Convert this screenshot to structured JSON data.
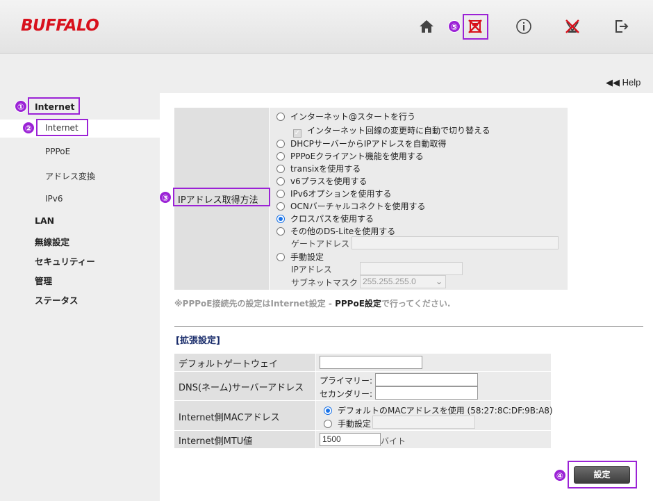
{
  "header": {
    "logo": "BUFFALO",
    "icons": [
      "home-icon",
      "network-disconnect-icon",
      "info-icon",
      "wireless-off-icon",
      "logout-icon"
    ]
  },
  "help": {
    "label": "Help"
  },
  "sidebar": {
    "items": [
      {
        "label": "Internet"
      },
      {
        "label": "Internet"
      },
      {
        "label": "PPPoE"
      },
      {
        "label": "アドレス変換"
      },
      {
        "label": "IPv6"
      },
      {
        "label": "LAN"
      },
      {
        "label": "無線設定"
      },
      {
        "label": "セキュリティー"
      },
      {
        "label": "管理"
      },
      {
        "label": "ステータス"
      }
    ]
  },
  "badges": [
    "①",
    "②",
    "③",
    "④",
    "⑤"
  ],
  "ip_method": {
    "label": "IPアドレス取得方法",
    "options": [
      "インターネット@スタートを行う",
      "インターネット回線の変更時に自動で切り替える",
      "DHCPサーバーからIPアドレスを自動取得",
      "PPPoEクライアント機能を使用する",
      "transixを使用する",
      "v6プラスを使用する",
      "IPv6オプションを使用する",
      "OCNバーチャルコネクトを使用する",
      "クロスパスを使用する",
      "その他のDS-Liteを使用する",
      "手動設定"
    ],
    "selected": "クロスパスを使用する",
    "gateway_label": "ゲートアドレス",
    "ip_label": "IPアドレス",
    "subnet_label": "サブネットマスク",
    "subnet_value": "255.255.255.0"
  },
  "note": {
    "prefix": "※PPPoE接続先の設定はInternet設定 - ",
    "link": "PPPoE設定",
    "suffix": "で行ってください."
  },
  "extended": {
    "title": "[拡張設定]",
    "default_gateway_label": "デフォルトゲートウェイ",
    "dns_label": "DNS(ネーム)サーバーアドレス",
    "primary_label": "プライマリー:",
    "secondary_label": "セカンダリー:",
    "mac_label": "Internet側MACアドレス",
    "mac_default_option": "デフォルトのMACアドレスを使用 (58:27:8C:DF:9B:A8)",
    "mac_manual_option": "手動設定",
    "mtu_label": "Internet側MTU値",
    "mtu_value": "1500",
    "mtu_unit": "バイト"
  },
  "actions": {
    "submit_label": "設定"
  },
  "colors": {
    "brand": "#d8111c",
    "highlight": "#9b22d6",
    "selected_radio": "#1a73e8"
  }
}
